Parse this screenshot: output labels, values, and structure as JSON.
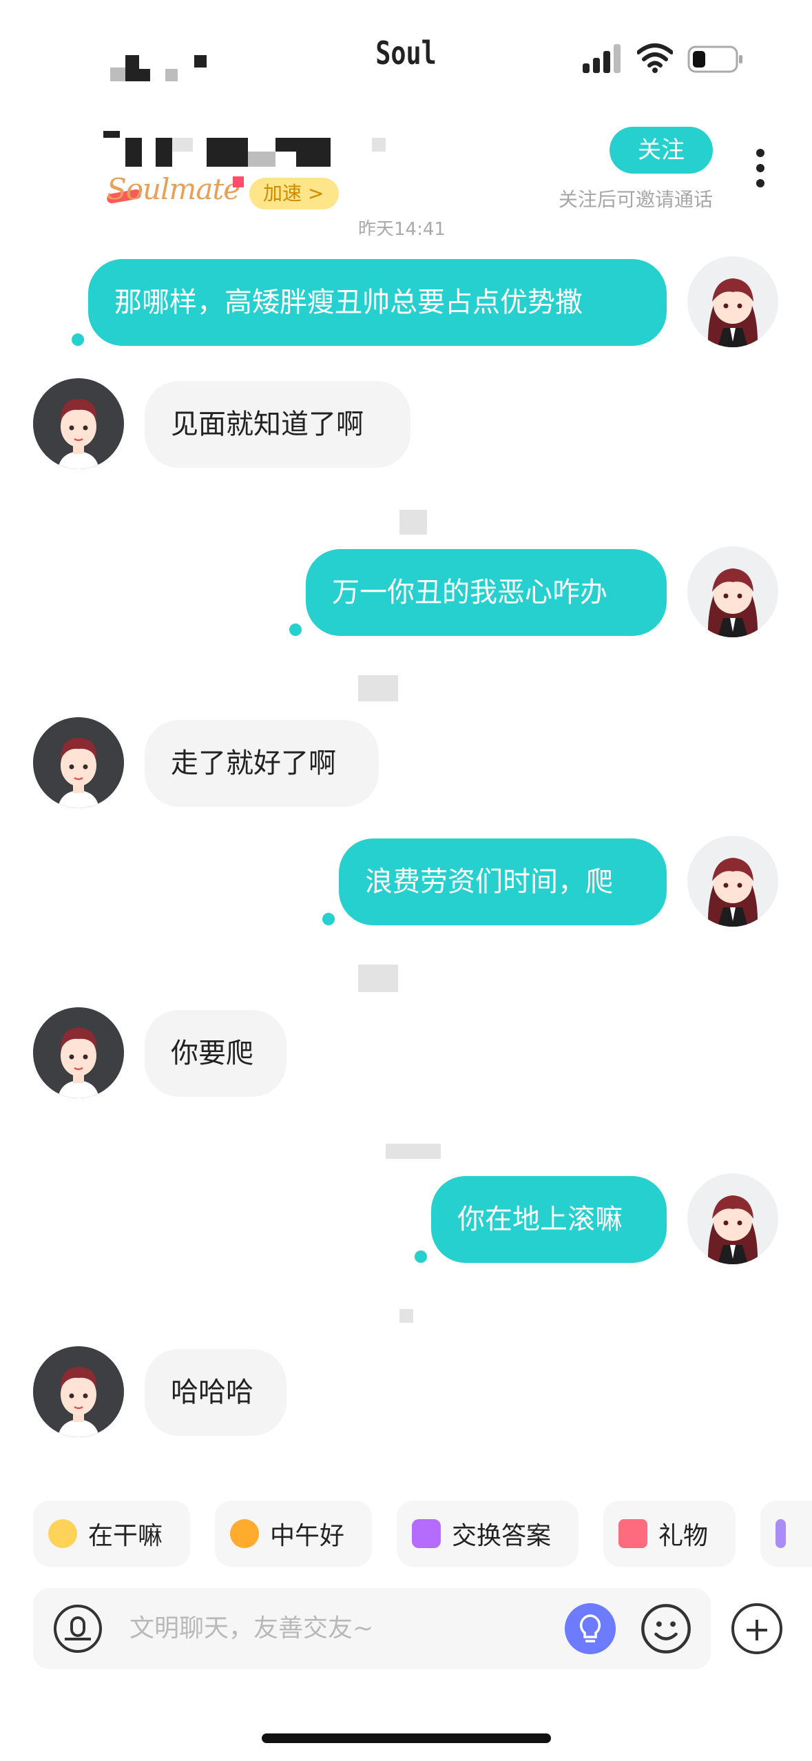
{
  "status_bar": {
    "app_name": "Soul"
  },
  "header": {
    "follow_label": "关注",
    "follow_hint": "关注后可邀请通话",
    "brand": "Soulmate",
    "boost_label": "加速 >",
    "time_partial": "昨天14:41"
  },
  "messages": [
    {
      "side": "out",
      "text": "那哪样，高矮胖瘦丑帅总要占点优势撒"
    },
    {
      "side": "in",
      "text": "见面就知道了啊"
    },
    {
      "side": "out",
      "text": "万一你丑的我恶心咋办"
    },
    {
      "side": "in",
      "text": "走了就好了啊"
    },
    {
      "side": "out",
      "text": "浪费劳资们时间，爬"
    },
    {
      "side": "in",
      "text": "你要爬"
    },
    {
      "side": "out",
      "text": "你在地上滚嘛"
    },
    {
      "side": "in",
      "text": "哈哈哈"
    }
  ],
  "quick_replies": [
    {
      "label": "在干嘛",
      "icon": "face-icon"
    },
    {
      "label": "中午好",
      "icon": "sun-icon"
    },
    {
      "label": "交换答案",
      "icon": "exchange-icon"
    },
    {
      "label": "礼物",
      "icon": "gift-icon"
    },
    {
      "label": "",
      "icon": "game-icon"
    }
  ],
  "input": {
    "placeholder": "文明聊天，友善交友~"
  },
  "colors": {
    "accent": "#25d0ce",
    "incoming_bubble": "#f4f4f4",
    "peer_avatar_bg": "#3d3f43"
  }
}
